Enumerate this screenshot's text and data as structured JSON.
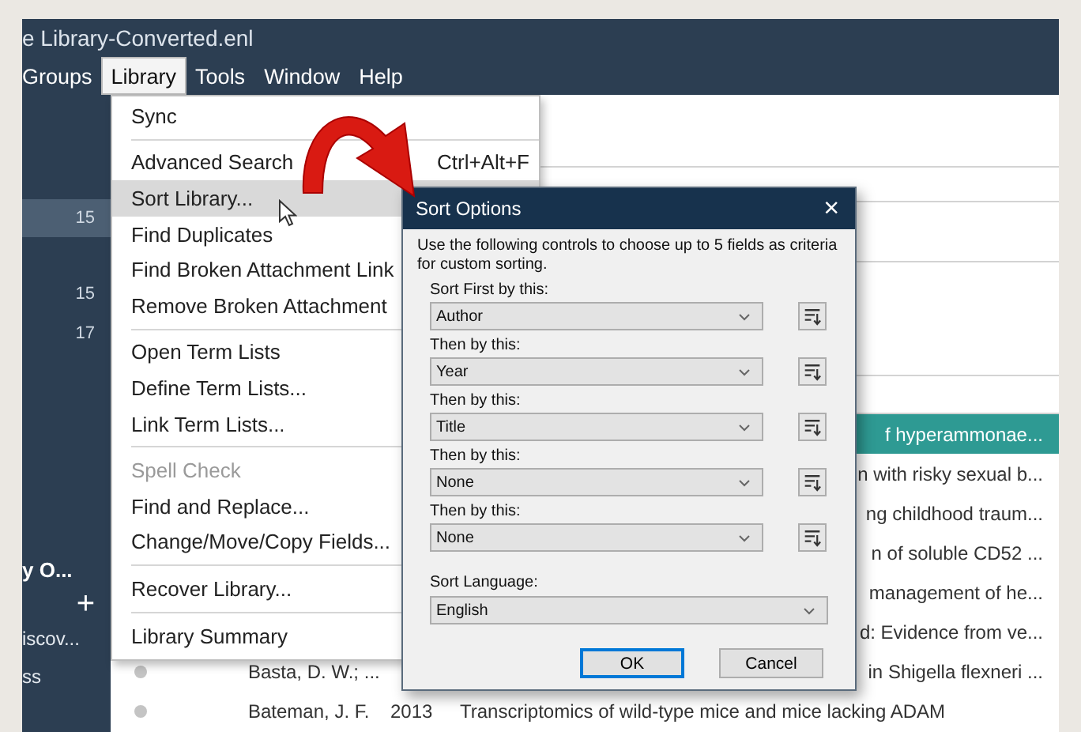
{
  "window": {
    "title": "e Library-Converted.enl"
  },
  "menu_bar": [
    {
      "label": "Groups",
      "selected": false
    },
    {
      "label": "Library",
      "selected": true
    },
    {
      "label": "Tools",
      "selected": false
    },
    {
      "label": "Window",
      "selected": false
    },
    {
      "label": "Help",
      "selected": false
    }
  ],
  "sidebar": {
    "counts": [
      {
        "count": "15",
        "selected": true
      },
      {
        "count": "15",
        "selected": false
      },
      {
        "count": "17",
        "selected": false
      }
    ],
    "section_title": "y O...",
    "add_button": "+",
    "items": [
      "iscov...",
      "ss"
    ]
  },
  "library_menu": [
    [
      {
        "label": "Sync",
        "selected": false,
        "disabled": false
      }
    ],
    [
      {
        "label": "Advanced Search",
        "shortcut": "Ctrl+Alt+F",
        "selected": false,
        "disabled": false
      },
      {
        "label": "Sort Library...",
        "selected": true,
        "disabled": false
      },
      {
        "label": "Find Duplicates",
        "selected": false,
        "disabled": false
      },
      {
        "label": "Find Broken Attachment Link",
        "selected": false,
        "disabled": false
      },
      {
        "label": "Remove Broken Attachment",
        "selected": false,
        "disabled": false
      }
    ],
    [
      {
        "label": "Open Term Lists",
        "selected": false,
        "disabled": false
      },
      {
        "label": "Define Term Lists...",
        "selected": false,
        "disabled": false
      },
      {
        "label": "Link Term Lists...",
        "selected": false,
        "disabled": false
      }
    ],
    [
      {
        "label": "Spell Check",
        "selected": false,
        "disabled": true
      },
      {
        "label": "Find and Replace...",
        "selected": false,
        "disabled": false
      },
      {
        "label": "Change/Move/Copy Fields...",
        "selected": false,
        "disabled": false
      }
    ],
    [
      {
        "label": "Recover Library...",
        "selected": false,
        "disabled": false
      }
    ],
    [
      {
        "label": "Library Summary",
        "selected": false,
        "disabled": false
      }
    ]
  ],
  "references": [
    {
      "title": "f hyperammonae...",
      "selected": true
    },
    {
      "title": "n with risky sexual b...",
      "selected": false
    },
    {
      "title": "ng childhood traum...",
      "selected": false
    },
    {
      "title": "n of soluble CD52 ...",
      "selected": false
    },
    {
      "title": "management of he...",
      "selected": false
    },
    {
      "title": "d: Evidence from ve...",
      "selected": false
    },
    {
      "author": "Basta, D. W.; ...",
      "title": "in Shigella flexneri ...",
      "selected": false
    },
    {
      "author": "Bateman, J. F.",
      "year": "2013",
      "title": "Transcriptomics of wild-type mice and mice lacking ADAM",
      "selected": false
    }
  ],
  "sort_dialog": {
    "title": "Sort Options",
    "close": "×",
    "description": "Use the following controls to choose up to 5 fields as criteria for custom sorting.",
    "sort_fields": [
      {
        "label": "Sort First by this:",
        "value": "Author"
      },
      {
        "label": "Then by this:",
        "value": "Year"
      },
      {
        "label": "Then by this:",
        "value": "Title"
      },
      {
        "label": "Then by this:",
        "value": "None"
      },
      {
        "label": "Then by this:",
        "value": "None"
      }
    ],
    "language": {
      "label": "Sort Language:",
      "value": "English"
    },
    "buttons": [
      {
        "label": "OK",
        "default": true
      },
      {
        "label": "Cancel",
        "default": false
      }
    ]
  }
}
